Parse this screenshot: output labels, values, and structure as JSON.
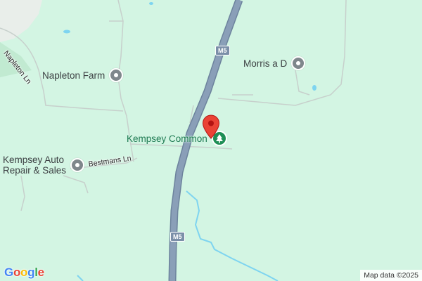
{
  "map": {
    "attribution": "Map data ©2025",
    "logo_letters": [
      {
        "ch": "G",
        "color": "#4285F4"
      },
      {
        "ch": "o",
        "color": "#EA4335"
      },
      {
        "ch": "o",
        "color": "#FBBC05"
      },
      {
        "ch": "g",
        "color": "#4285F4"
      },
      {
        "ch": "l",
        "color": "#34A853"
      },
      {
        "ch": "e",
        "color": "#EA4335"
      }
    ],
    "colors": {
      "land": "#d3f5e3",
      "motorway": "#8a9fb8",
      "water": "#7ed4f0",
      "marker": "#ea4335",
      "park_pin": "#1e8e55"
    }
  },
  "roads": {
    "napleton_ln": "Napleton Ln",
    "bestmans_ln": "Bestmans Ln",
    "m5_top": "M5",
    "m5_bottom": "M5"
  },
  "places": {
    "napleton_farm": {
      "label": "Napleton Farm",
      "icon": "gray-pin-icon"
    },
    "morris": {
      "label": "Morris a D",
      "icon": "gray-pin-icon"
    },
    "kempsey_common": {
      "label": "Kempsey Common",
      "icon": "park-tree-icon"
    },
    "kempsey_auto": {
      "line1": "Kempsey Auto",
      "line2": "Repair & Sales",
      "icon": "gray-pin-icon"
    }
  },
  "marker": {
    "icon": "red-location-marker-icon"
  }
}
